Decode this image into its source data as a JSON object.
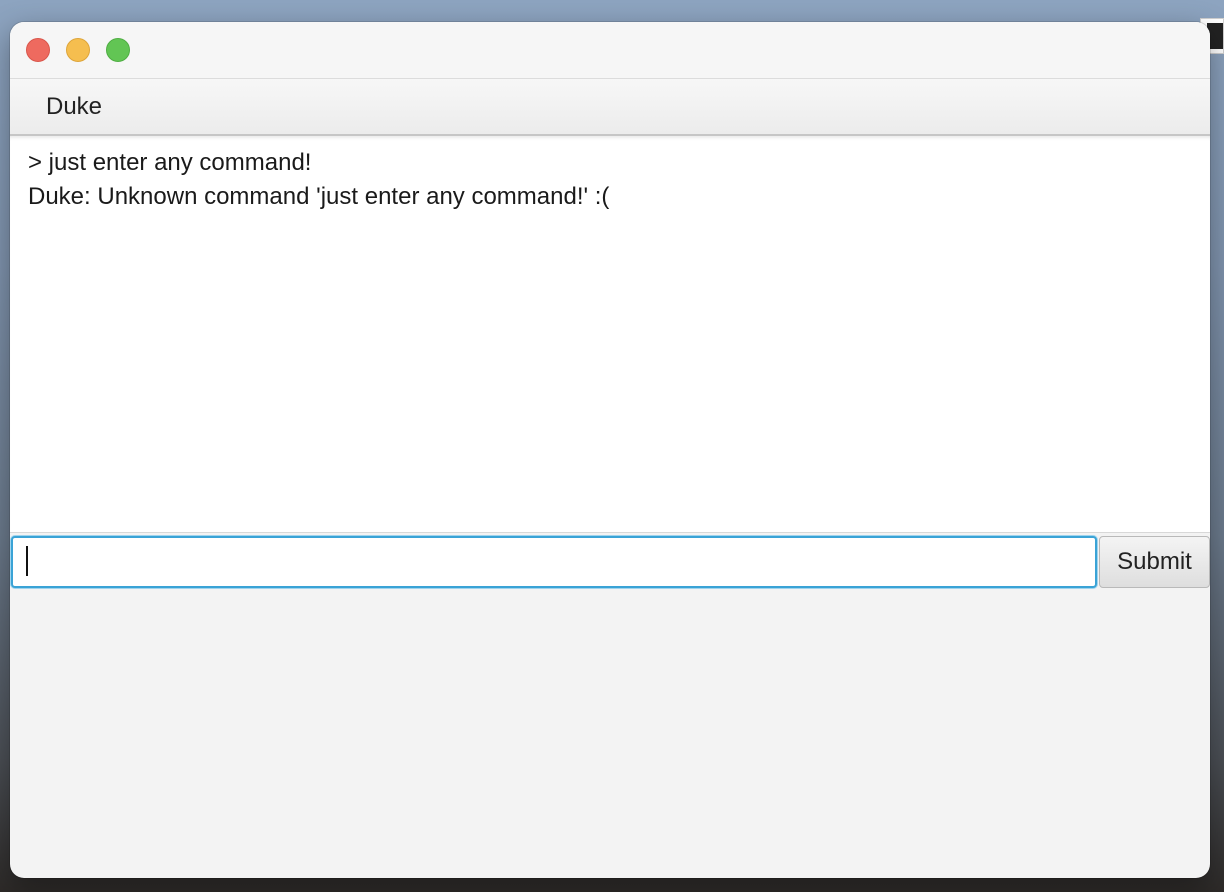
{
  "window": {
    "controls": {
      "close_icon": "close-icon",
      "minimize_icon": "minimize-icon",
      "zoom_icon": "zoom-icon",
      "colors": {
        "close": "#ee6a5f",
        "minimize": "#f5be4f",
        "zoom": "#62c554"
      }
    }
  },
  "menubar": {
    "items": [
      {
        "label": "Duke"
      }
    ]
  },
  "output": {
    "lines": [
      "> just enter any command!",
      "Duke: Unknown command 'just enter any command!' :("
    ]
  },
  "input": {
    "value": "",
    "placeholder": "",
    "focus_color": "#3aa3d6"
  },
  "submit": {
    "label": "Submit"
  }
}
